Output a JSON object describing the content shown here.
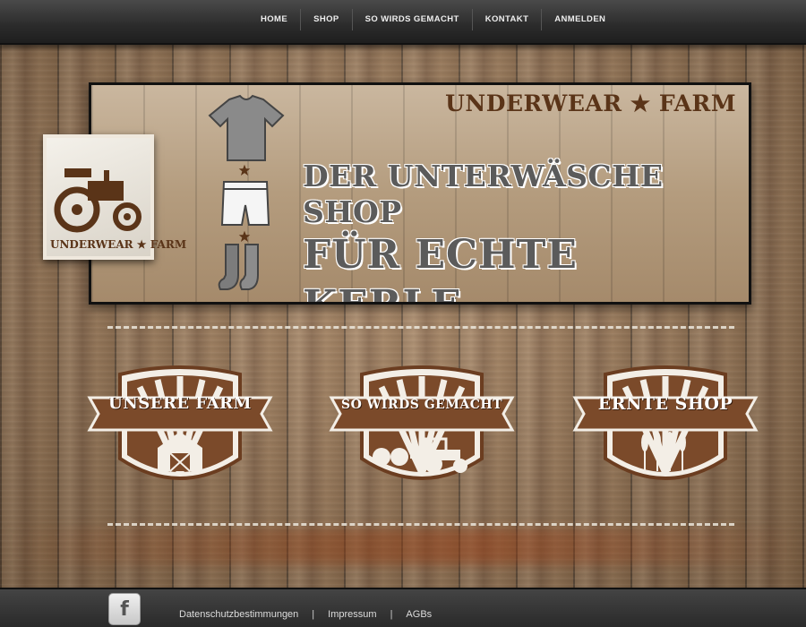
{
  "nav": {
    "items": [
      "HOME",
      "SHOP",
      "SO WIRDS GEMACHT",
      "KONTAKT",
      "ANMELDEN"
    ]
  },
  "banner": {
    "brand": "UNDERWEAR ★ FARM",
    "headline_1": "DER UNTERWÄSCHE SHOP",
    "headline_2": "FÜR ECHTE KERLE"
  },
  "logo_card": {
    "text": "UNDERWEAR ★ FARM"
  },
  "badges": [
    {
      "label": "UNSERE FARM",
      "icon": "barn-icon"
    },
    {
      "label": "SO WIRDS GEMACHT",
      "icon": "tractor-icon"
    },
    {
      "label": "ERNTE SHOP",
      "icon": "wheat-icon"
    }
  ],
  "footer": {
    "facebook": "f",
    "links": [
      "Datenschutzbestimmungen",
      "Impressum",
      "AGBs"
    ],
    "separator": "|"
  },
  "colors": {
    "brand_brown": "#5a3418",
    "badge_brown": "#7b4a2a",
    "nav_bg": "#2b2b2b"
  }
}
